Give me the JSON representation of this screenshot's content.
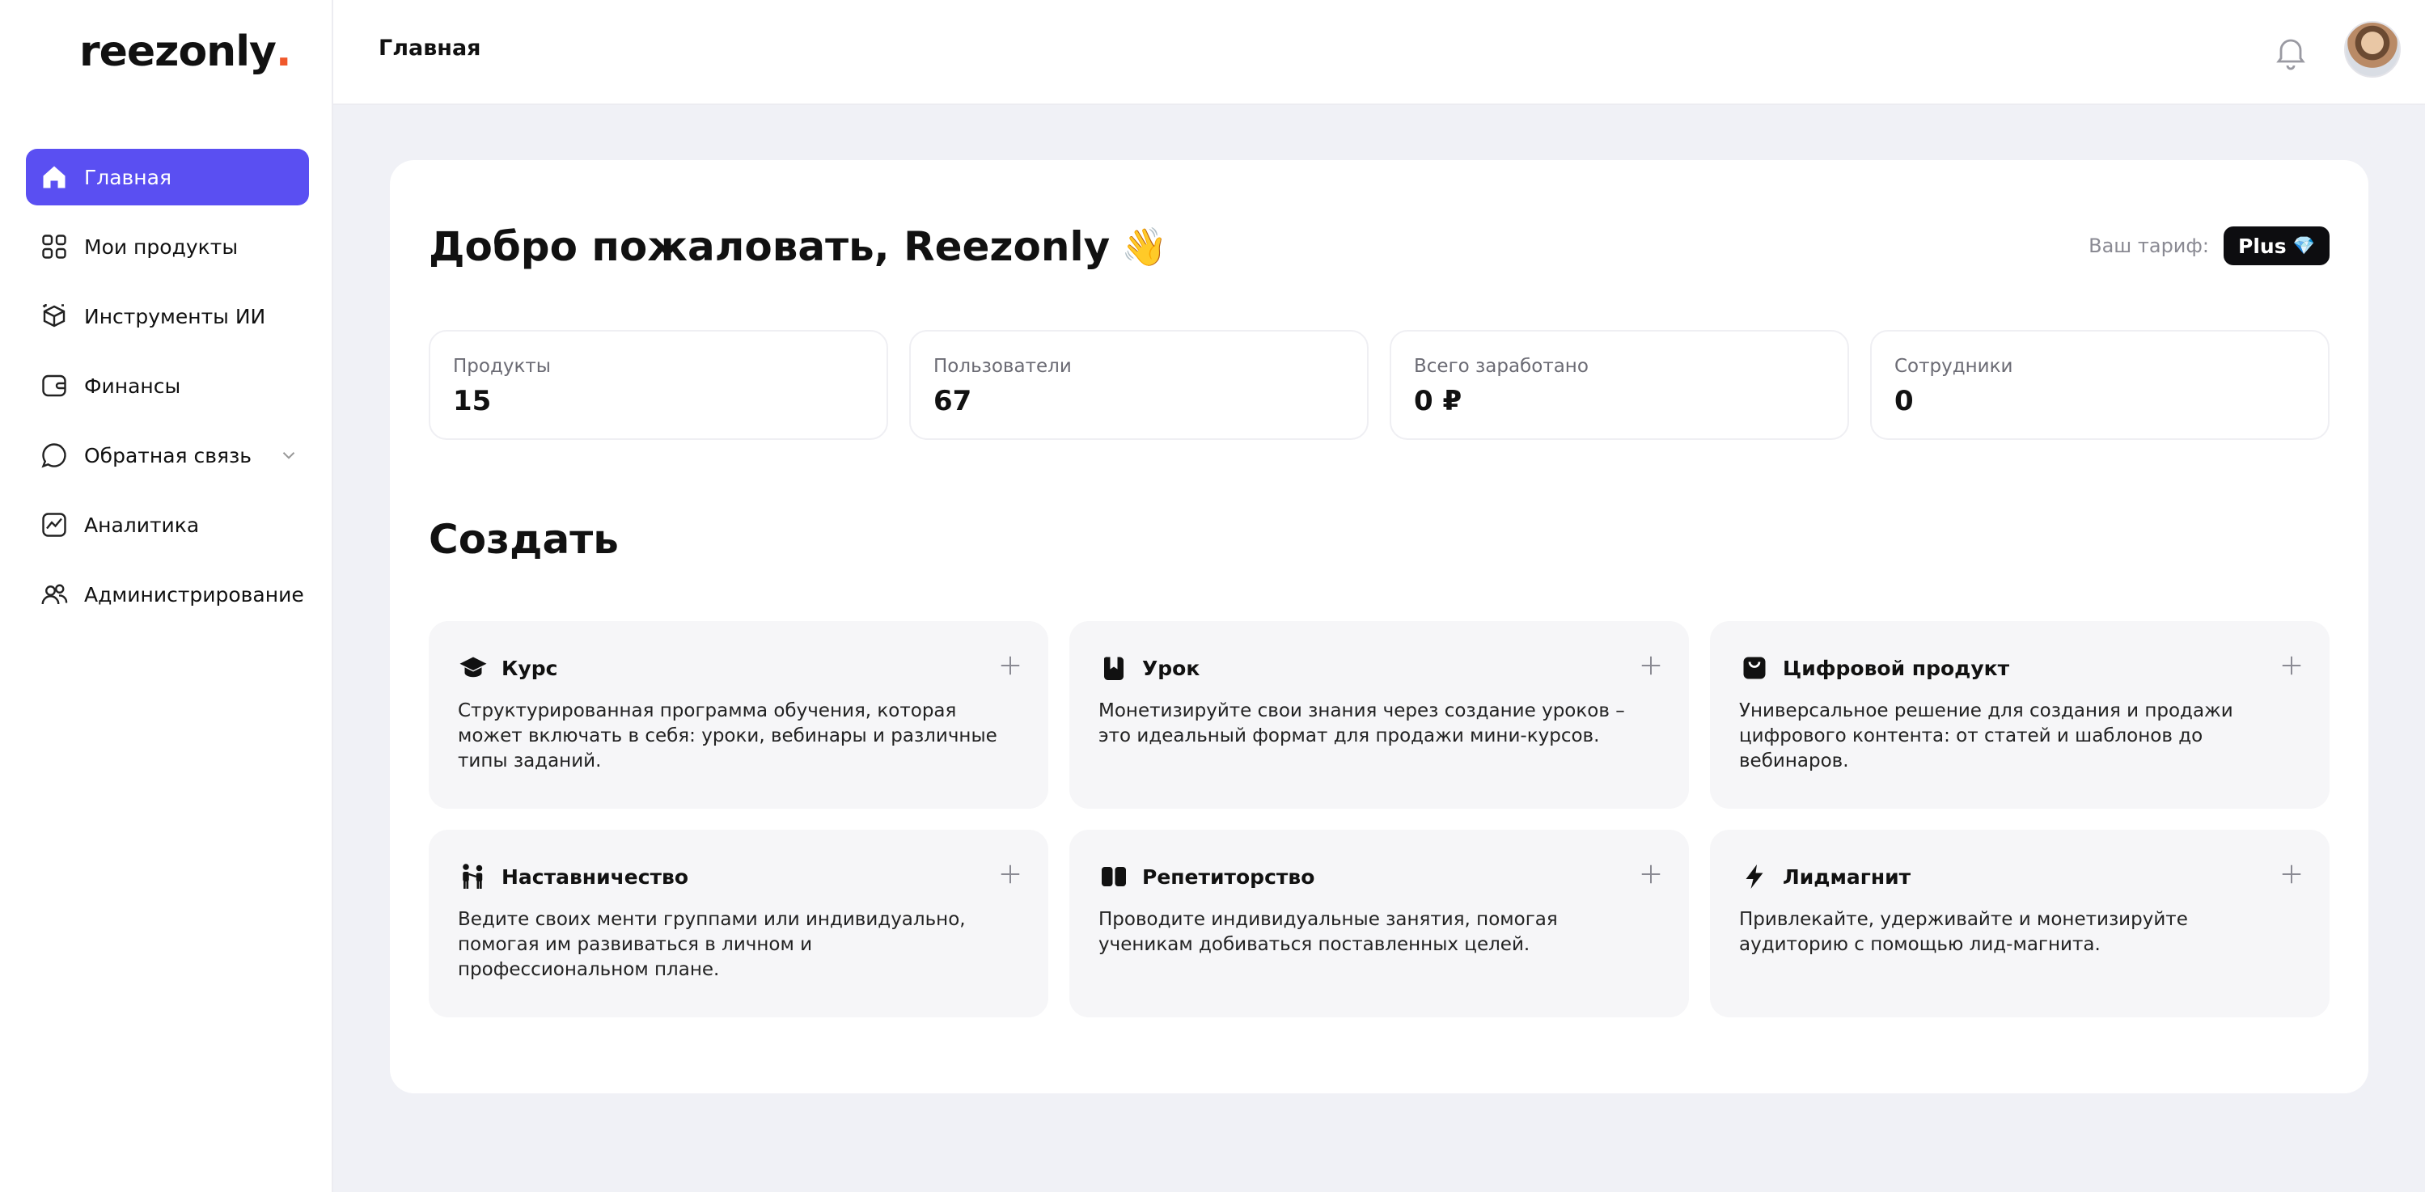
{
  "app": {
    "logo_text": "reezonly",
    "logo_dot": "."
  },
  "sidebar": {
    "items": [
      {
        "label": "Главная",
        "icon": "home-icon",
        "active": true
      },
      {
        "label": "Мои продукты",
        "icon": "grid-icon"
      },
      {
        "label": "Инструменты ИИ",
        "icon": "ai-cube-icon"
      },
      {
        "label": "Финансы",
        "icon": "wallet-icon"
      },
      {
        "label": "Обратная связь",
        "icon": "chat-bubble-icon",
        "has_dropdown": true
      },
      {
        "label": "Аналитика",
        "icon": "analytics-chart-icon"
      },
      {
        "label": "Администрирование",
        "icon": "users-icon"
      }
    ]
  },
  "header": {
    "title": "Главная",
    "bell_icon": "bell-icon",
    "avatar": "user-avatar"
  },
  "main": {
    "welcome": "Добро пожаловать, Reezonly",
    "wave_emoji": "👋",
    "plan_label": "Ваш тариф:",
    "plan_name": "Plus",
    "plan_gem": "💎",
    "stats": [
      {
        "name": "Продукты",
        "value": "15"
      },
      {
        "name": "Пользователи",
        "value": "67"
      },
      {
        "name": "Всего заработано",
        "value": "0 ₽"
      },
      {
        "name": "Сотрудники",
        "value": "0"
      }
    ],
    "create_title": "Создать",
    "tiles": [
      {
        "title": "Курс",
        "icon": "graduation-cap-icon",
        "desc": "Структурированная программа обучения, которая может включать в себя: уроки, вебинары и различные типы заданий."
      },
      {
        "title": "Урок",
        "icon": "lesson-icon",
        "desc": "Монетизируйте свои знания через создание уроков – это идеальный формат для продажи мини-курсов."
      },
      {
        "title": "Цифровой продукт",
        "icon": "shopping-bag-icon",
        "desc": "Универсальное решение для создания и продажи цифрового контента: от статей и шаблонов до вебинаров."
      },
      {
        "title": "Наставничество",
        "icon": "mentorship-icon",
        "desc": "Ведите своих менти группами или индивидуально, помогая им развиваться в личном и профессиональном плане."
      },
      {
        "title": "Репетиторство",
        "icon": "open-book-icon",
        "desc": "Проводите индивидуальные занятия, помогая ученикам добиваться поставленных целей."
      },
      {
        "title": "Лидмагнит",
        "icon": "lightning-icon",
        "desc": "Привлекайте, удерживайте и монетизируйте аудиторию с помощью лид-магнита."
      }
    ]
  },
  "colors": {
    "accent": "#5a4ff2",
    "logo_dot": "#f0582b",
    "background": "#f0f1f6",
    "tile": "#f6f6f8"
  }
}
